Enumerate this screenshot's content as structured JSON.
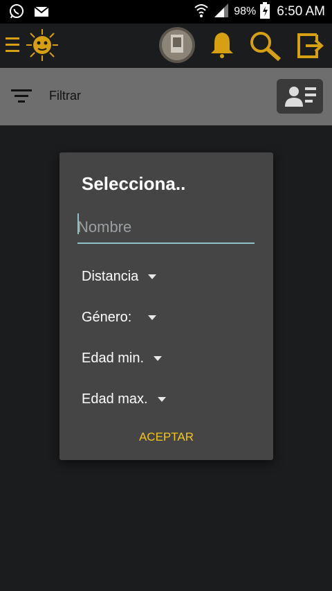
{
  "status_bar": {
    "battery": "98%",
    "time": "6:50 AM"
  },
  "app_bar": {
    "accent_color": "#d6a012",
    "icons": [
      "menu-icon",
      "logo-icon",
      "avatar",
      "bell-icon",
      "search-icon",
      "logout-icon"
    ]
  },
  "filter_bar": {
    "label": "Filtrar"
  },
  "dialog": {
    "title": "Selecciona..",
    "name_placeholder": "Nombre",
    "spinners": {
      "distance": "Distancia",
      "gender": "Género:",
      "min_age": "Edad min.",
      "max_age": "Edad max."
    },
    "accept_label": "ACEPTAR",
    "accent_color": "#f5c518"
  }
}
